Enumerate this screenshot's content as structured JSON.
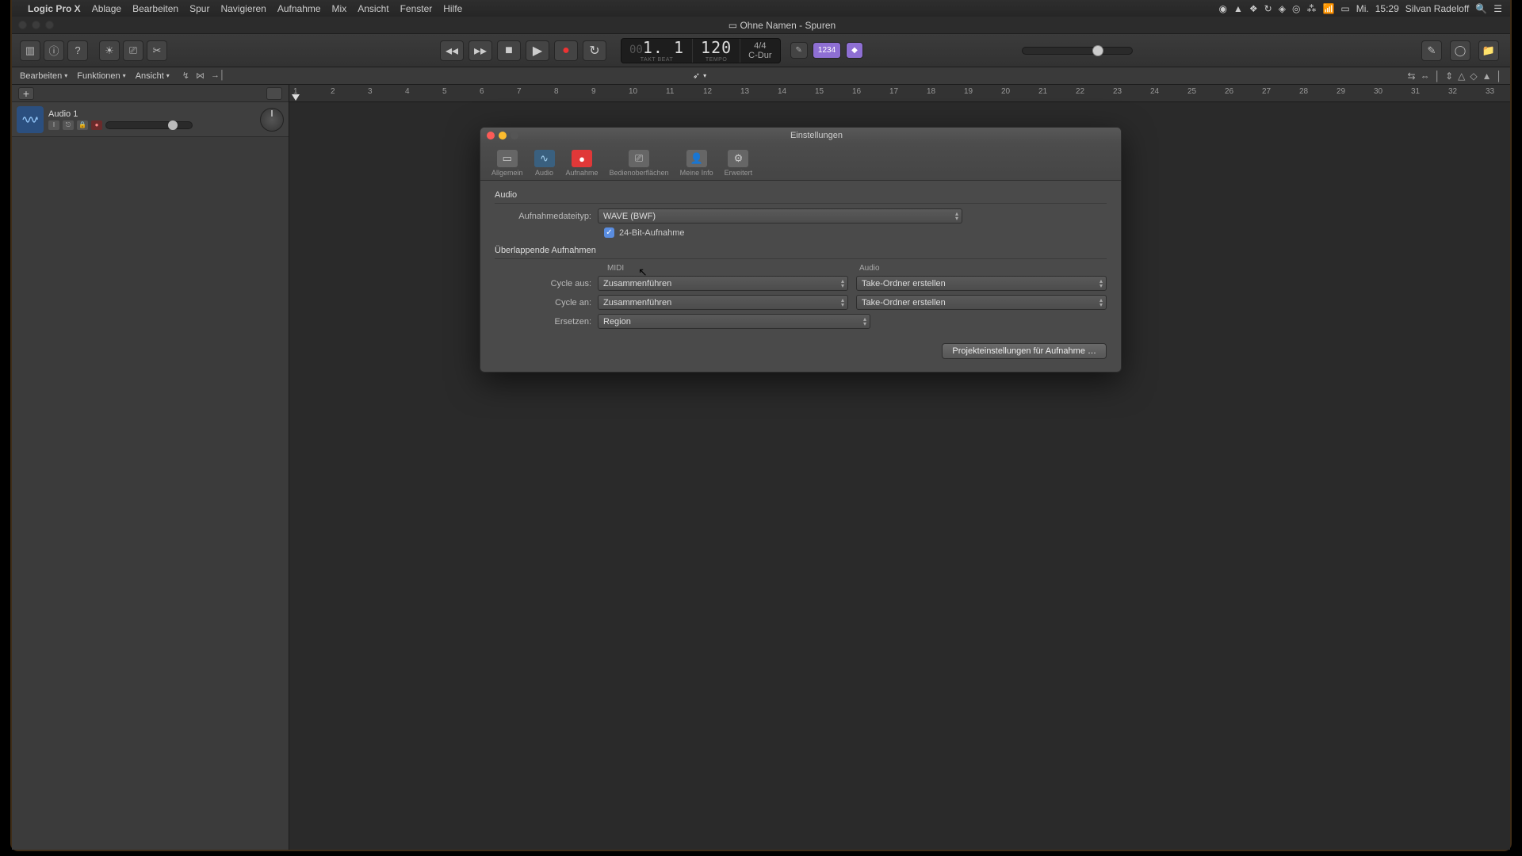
{
  "menubar": {
    "app": "Logic Pro X",
    "items": [
      "Ablage",
      "Bearbeiten",
      "Spur",
      "Navigieren",
      "Aufnahme",
      "Mix",
      "Ansicht",
      "Fenster",
      "Hilfe"
    ],
    "clock_day": "Mi.",
    "clock_time": "15:29",
    "user": "Silvan Radeloff"
  },
  "window": {
    "title": "Ohne Namen - Spuren"
  },
  "lcd": {
    "pos_prefix": "00",
    "position": "1. 1",
    "position_sub": "TAKT        BEAT",
    "tempo": "120",
    "tempo_sub": "TEMPO",
    "sig": "4/4",
    "key": "C-Dur"
  },
  "chips": {
    "edit": "✎",
    "count": "1234",
    "met": "◆"
  },
  "toolbar2": {
    "menus": [
      "Bearbeiten",
      "Funktionen",
      "Ansicht"
    ]
  },
  "track": {
    "name": "Audio 1"
  },
  "ruler_ticks": [
    "1",
    "2",
    "3",
    "4",
    "5",
    "6",
    "7",
    "8",
    "9",
    "10",
    "11",
    "12",
    "13",
    "14",
    "15",
    "16",
    "17",
    "18",
    "19",
    "20",
    "21",
    "22",
    "23",
    "24",
    "25",
    "26",
    "27",
    "28",
    "29",
    "30",
    "31",
    "32",
    "33"
  ],
  "dialog": {
    "title": "Einstellungen",
    "tabs": {
      "allgemein": "Allgemein",
      "audio": "Audio",
      "aufnahme": "Aufnahme",
      "bedien": "Bedienoberflächen",
      "meine": "Meine Info",
      "erweitert": "Erweitert"
    },
    "audio_section": "Audio",
    "filetype_label": "Aufnahmedateityp:",
    "filetype_value": "WAVE (BWF)",
    "bit_checkbox": "24-Bit-Aufnahme",
    "overlap_section": "Überlappende Aufnahmen",
    "col_midi": "MIDI",
    "col_audio": "Audio",
    "cycle_aus_label": "Cycle aus:",
    "cycle_aus_midi": "Zusammenführen",
    "cycle_aus_audio": "Take-Ordner erstellen",
    "cycle_an_label": "Cycle an:",
    "cycle_an_midi": "Zusammenführen",
    "cycle_an_audio": "Take-Ordner erstellen",
    "ersetzen_label": "Ersetzen:",
    "ersetzen_value": "Region",
    "footer_btn": "Projekteinstellungen für Aufnahme …"
  }
}
